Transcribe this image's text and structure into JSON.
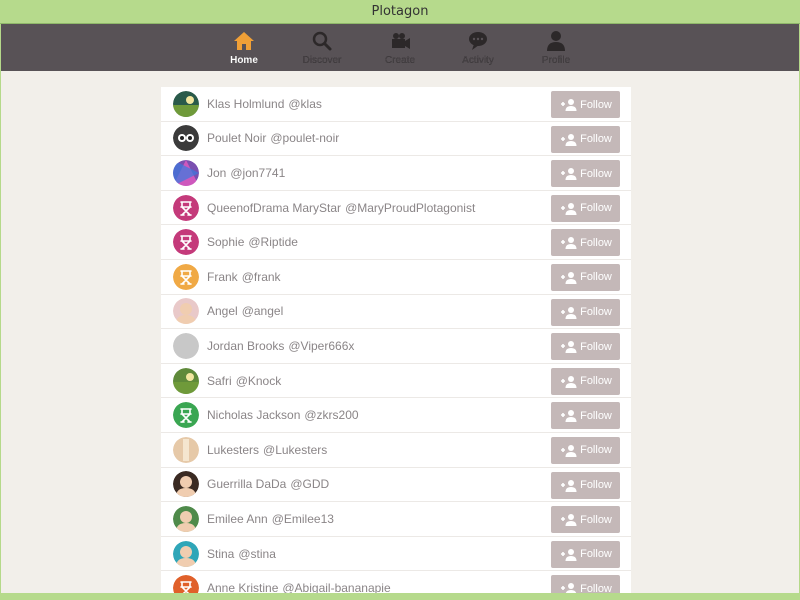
{
  "window": {
    "title": "Plotagon"
  },
  "nav": {
    "items": [
      {
        "label": "Home",
        "icon": "home-icon",
        "active": true
      },
      {
        "label": "Discover",
        "icon": "search-icon",
        "active": false
      },
      {
        "label": "Create",
        "icon": "camera-icon",
        "active": false
      },
      {
        "label": "Activity",
        "icon": "chat-bubble-icon",
        "active": false
      },
      {
        "label": "Profile",
        "icon": "person-icon",
        "active": false
      }
    ]
  },
  "colors": {
    "titlebar": "#b6da8c",
    "navbar": "#585256",
    "home_icon": "#f0a037",
    "follow_button": "#c4b8b8",
    "content_bg": "#f2efea"
  },
  "follow_label": "Follow",
  "users": [
    {
      "name": "Klas Holmlund",
      "handle": "@klas",
      "avatar": "photo-landscape",
      "avatar_color": "#2a5a4a"
    },
    {
      "name": "Poulet Noir",
      "handle": "@poulet-noir",
      "avatar": "photo-glasses",
      "avatar_color": "#3b3b3b"
    },
    {
      "name": "Jon",
      "handle": "@jon7741",
      "avatar": "photo-abstract",
      "avatar_color": "#7a4fb0"
    },
    {
      "name": "QueenofDrama MaryStar",
      "handle": "@MaryProudPlotagonist",
      "avatar": "director-chair-icon",
      "avatar_color": "#c43a7a"
    },
    {
      "name": "Sophie",
      "handle": "@Riptide",
      "avatar": "director-chair-icon",
      "avatar_color": "#c43a7a"
    },
    {
      "name": "Frank",
      "handle": "@frank",
      "avatar": "director-chair-icon",
      "avatar_color": "#f0a945"
    },
    {
      "name": "Angel",
      "handle": "@angel",
      "avatar": "photo-face",
      "avatar_color": "#e9c9c9"
    },
    {
      "name": "Jordan Brooks",
      "handle": "@Viper666x",
      "avatar": "blank",
      "avatar_color": "#c8c8c8"
    },
    {
      "name": "Safri",
      "handle": "@Knock",
      "avatar": "photo-landscape",
      "avatar_color": "#5f8a3a"
    },
    {
      "name": "Nicholas Jackson",
      "handle": "@zkrs200",
      "avatar": "director-chair-icon",
      "avatar_color": "#3aa652"
    },
    {
      "name": "Lukesters",
      "handle": "@Lukesters",
      "avatar": "photo-figure",
      "avatar_color": "#e6c9a8"
    },
    {
      "name": "Guerrilla DaDa",
      "handle": "@GDD",
      "avatar": "photo-face",
      "avatar_color": "#3a2a22"
    },
    {
      "name": "Emilee Ann",
      "handle": "@Emilee13",
      "avatar": "photo-face",
      "avatar_color": "#4f8a4a"
    },
    {
      "name": "Stina",
      "handle": "@stina",
      "avatar": "photo-face",
      "avatar_color": "#2fa6b8"
    },
    {
      "name": "Anne Kristine",
      "handle": "@Abigail-bananapie",
      "avatar": "director-chair-icon",
      "avatar_color": "#e0602a"
    }
  ]
}
